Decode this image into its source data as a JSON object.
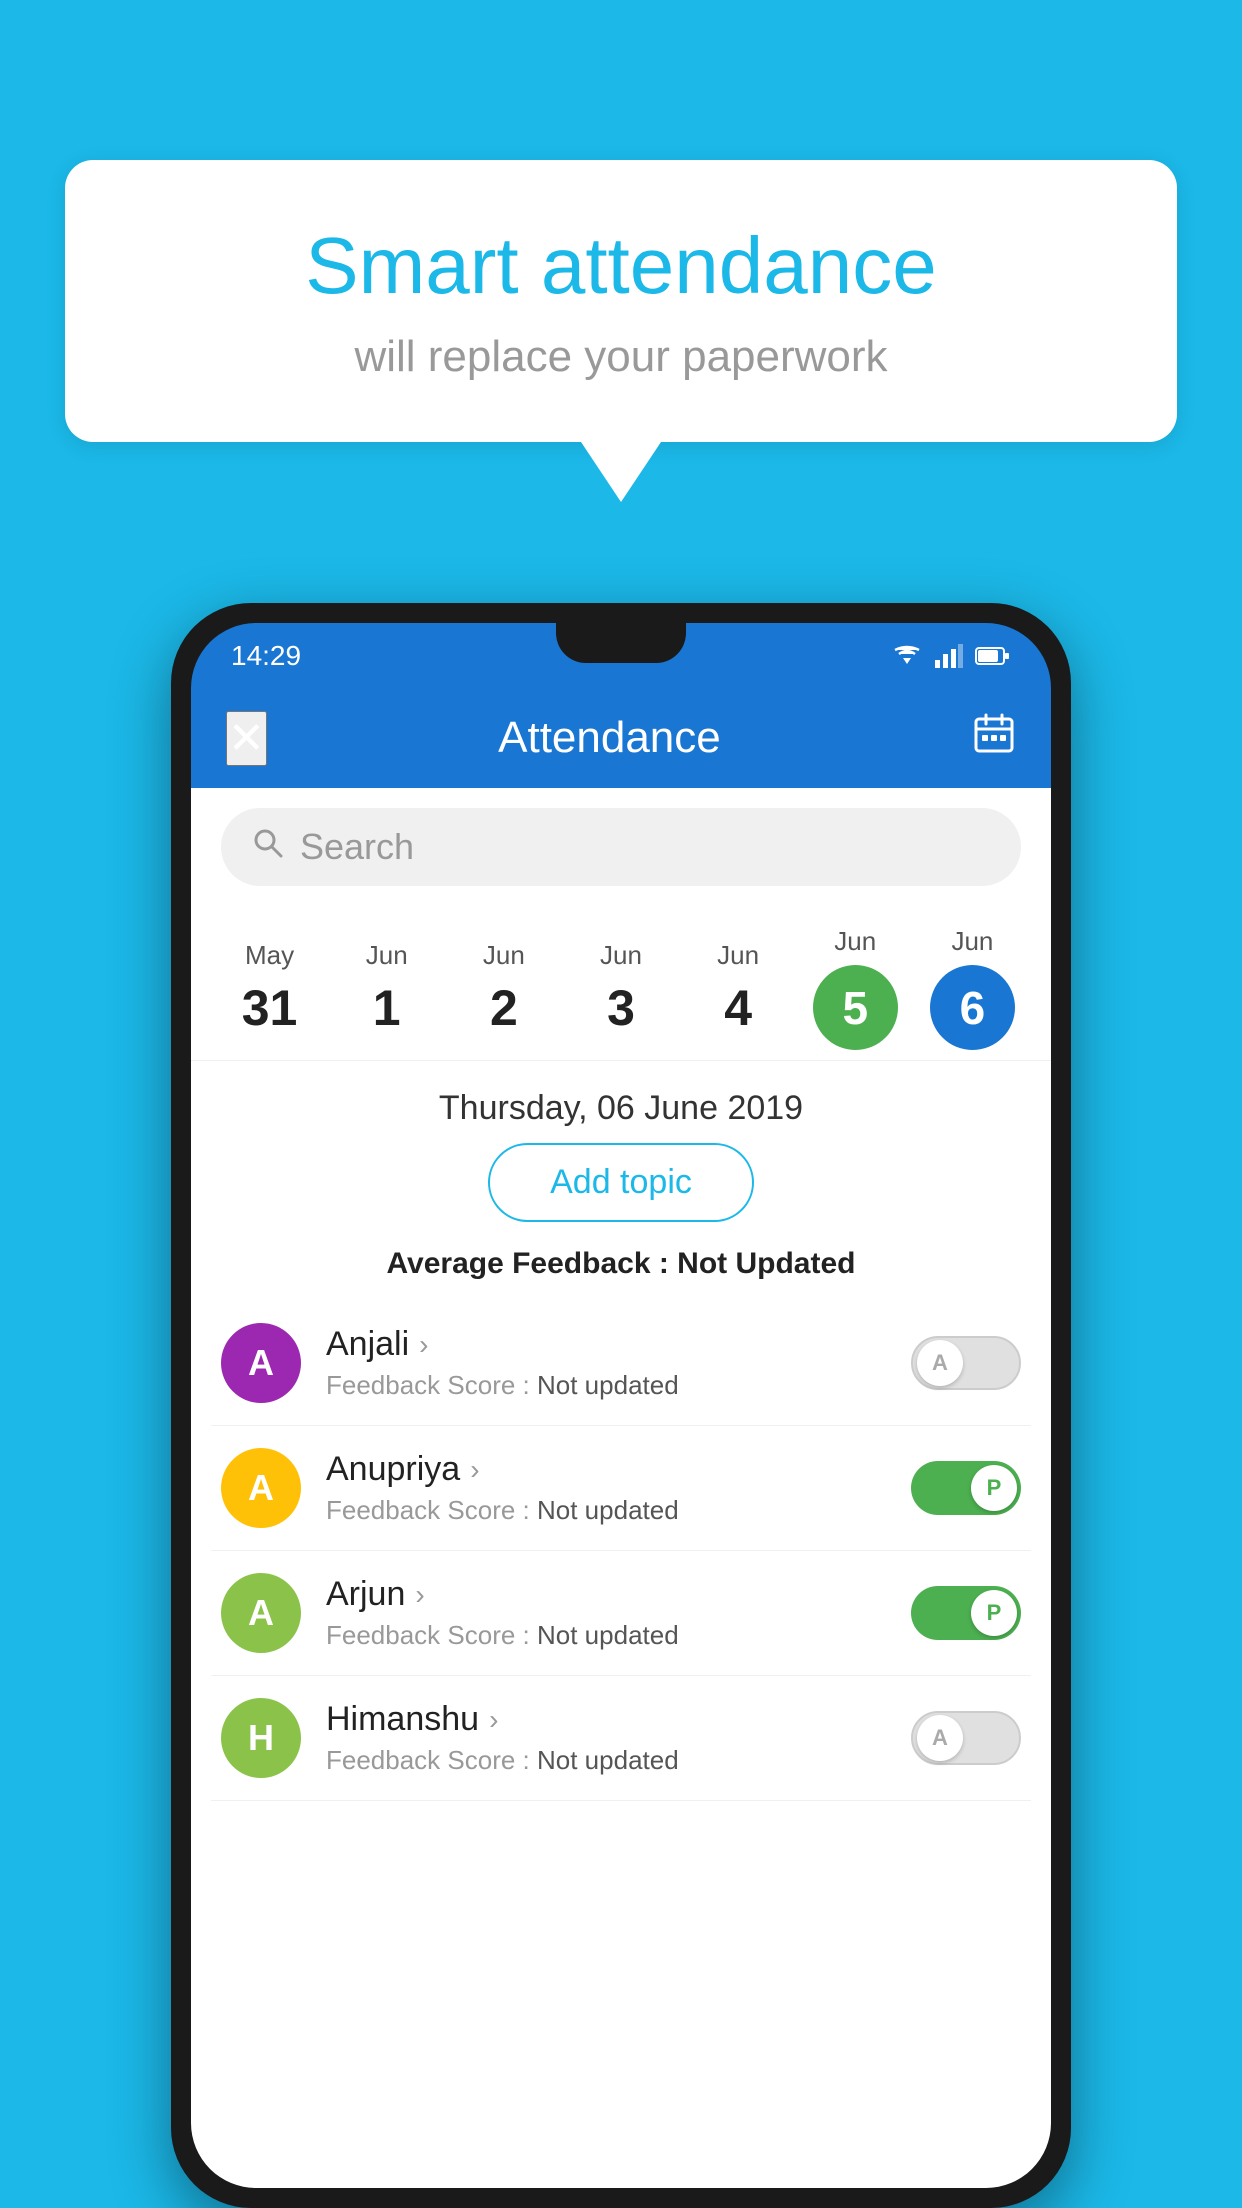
{
  "background_color": "#1bb8e8",
  "speech_bubble": {
    "title": "Smart attendance",
    "subtitle": "will replace your paperwork"
  },
  "status_bar": {
    "time": "14:29"
  },
  "app_bar": {
    "title": "Attendance",
    "close_label": "✕"
  },
  "search": {
    "placeholder": "Search"
  },
  "dates": [
    {
      "month": "May",
      "day": "31",
      "state": "normal"
    },
    {
      "month": "Jun",
      "day": "1",
      "state": "normal"
    },
    {
      "month": "Jun",
      "day": "2",
      "state": "normal"
    },
    {
      "month": "Jun",
      "day": "3",
      "state": "normal"
    },
    {
      "month": "Jun",
      "day": "4",
      "state": "normal"
    },
    {
      "month": "Jun",
      "day": "5",
      "state": "today"
    },
    {
      "month": "Jun",
      "day": "6",
      "state": "selected"
    }
  ],
  "selected_date_label": "Thursday, 06 June 2019",
  "add_topic_label": "Add topic",
  "average_feedback": {
    "label": "Average Feedback : ",
    "value": "Not Updated"
  },
  "students": [
    {
      "name": "Anjali",
      "initial": "A",
      "avatar_color": "#9c27b0",
      "feedback_label": "Feedback Score : ",
      "feedback_value": "Not updated",
      "toggle_state": "off",
      "toggle_label": "A"
    },
    {
      "name": "Anupriya",
      "initial": "A",
      "avatar_color": "#ffc107",
      "feedback_label": "Feedback Score : ",
      "feedback_value": "Not updated",
      "toggle_state": "on",
      "toggle_label": "P"
    },
    {
      "name": "Arjun",
      "initial": "A",
      "avatar_color": "#8bc34a",
      "feedback_label": "Feedback Score : ",
      "feedback_value": "Not updated",
      "toggle_state": "on",
      "toggle_label": "P"
    },
    {
      "name": "Himanshu",
      "initial": "H",
      "avatar_color": "#8bc34a",
      "feedback_label": "Feedback Score : ",
      "feedback_value": "Not updated",
      "toggle_state": "off",
      "toggle_label": "A"
    }
  ]
}
